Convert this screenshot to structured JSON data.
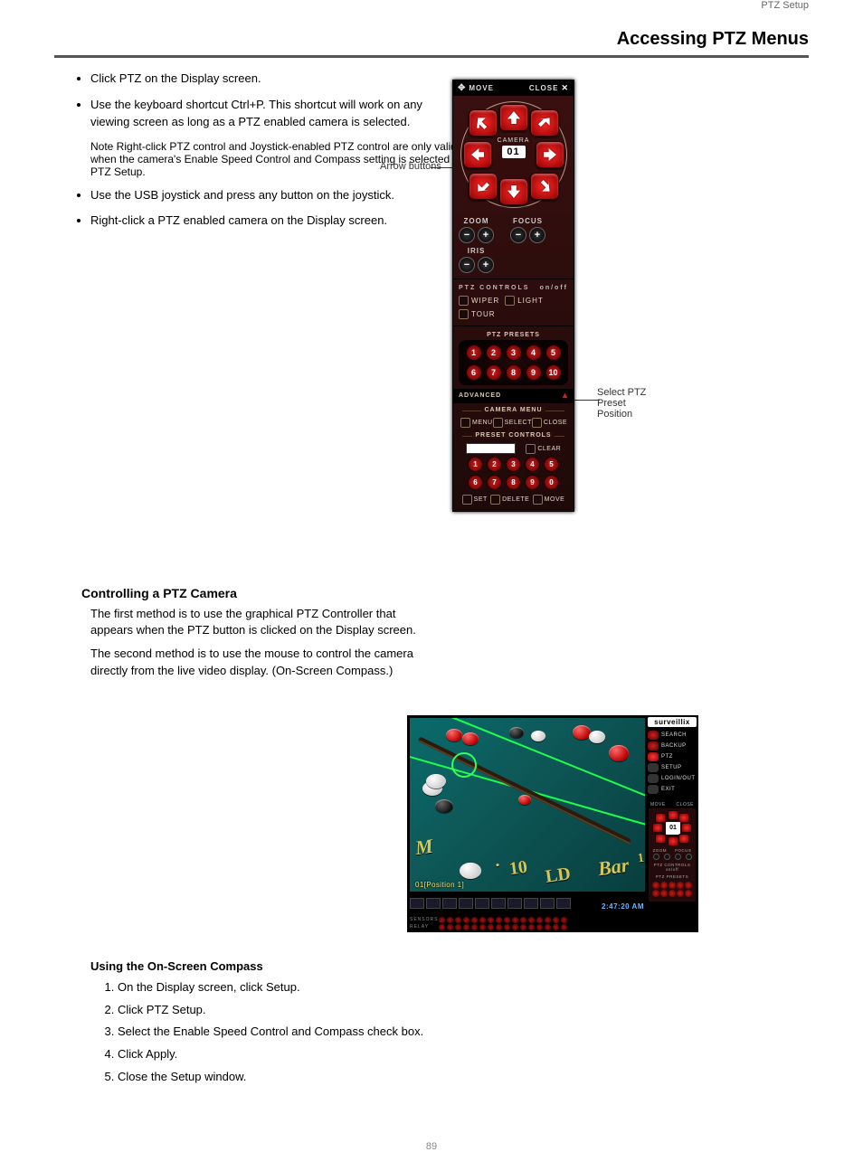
{
  "page": {
    "header_right": "PTZ Setup",
    "title": "Accessing PTZ Menus",
    "footer": "89"
  },
  "steps": [
    "Click PTZ on the Display screen.",
    "Use the keyboard shortcut Ctrl+P. This shortcut will work on any viewing screen as long as a PTZ enabled camera is selected.",
    "Use the USB joystick and press any button on the joystick.",
    "Right-click a PTZ enabled camera on the Display screen."
  ],
  "note": "Note  Right-click PTZ control and Joystick-enabled PTZ control are only valid when the camera's Enable Speed Control and Compass setting is selected in PTZ Setup.",
  "callouts": {
    "arrow": "Arrow buttons",
    "presets": "Select PTZ Preset Position"
  },
  "ptz": {
    "titlebar": {
      "move": "MOVE",
      "close": "CLOSE"
    },
    "camera_label": "CAMERA",
    "camera_num": "01",
    "zoom": "ZOOM",
    "focus": "FOCUS",
    "iris": "IRIS",
    "controls_head": "PTZ CONTROLS",
    "controls_onoff": "on/off",
    "wiper": "WIPER",
    "light": "LIGHT",
    "tour": "TOUR",
    "presets_head": "PTZ PRESETS",
    "presets_main": [
      "1",
      "2",
      "3",
      "4",
      "5",
      "6",
      "7",
      "8",
      "9",
      "10"
    ],
    "advanced": "ADVANCED",
    "camera_menu": "CAMERA MENU",
    "menu": "MENU",
    "select": "SELECT",
    "close_btn": "CLOSE",
    "preset_controls": "PRESET CONTROLS",
    "clear": "CLEAR",
    "preset_pad2": [
      "1",
      "2",
      "3",
      "4",
      "5",
      "6",
      "7",
      "8",
      "9",
      "0"
    ],
    "set": "SET",
    "delete": "DELETE",
    "move_btn": "MOVE"
  },
  "compass": {
    "heading": "Controlling a PTZ Camera",
    "intro": "The first method is to use the graphical PTZ Controller that appears when the PTZ button is clicked on the Display screen.",
    "sub": "The second method is to use the mouse to control the camera directly from the live video display. (On-Screen Compass.)",
    "sub_head": "Using the On-Screen Compass",
    "steps": [
      "On the Display screen, click Setup.",
      "Click PTZ Setup.",
      "Select the Enable Speed Control and Compass check box.",
      "Click Apply.",
      "Close the Setup window."
    ]
  },
  "live": {
    "brand": "surveillix",
    "right_buttons": [
      "SEARCH",
      "BACKUP",
      "PTZ",
      "SETUP",
      "LOGIN/OUT",
      "EXIT"
    ],
    "cam_overlay": "01[Position 1]",
    "time": "2:47:20 AM",
    "date": "",
    "sensors": "SENSORS",
    "relay": "RELAY",
    "mini_move": "MOVE",
    "mini_close": "CLOSE",
    "mini_cam": "01",
    "mini_zoom": "ZOOM",
    "mini_focus": "FOCUS",
    "mini_ctrl": "PTZ CONTROLS on/off",
    "mini_presets": "PTZ PRESETS"
  }
}
